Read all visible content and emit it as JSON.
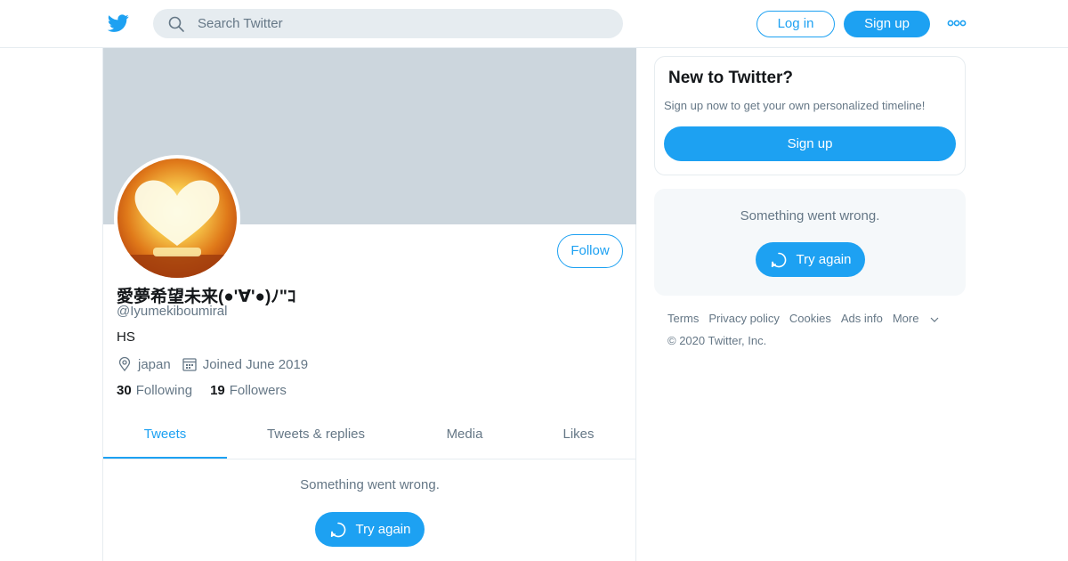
{
  "header": {
    "logo_icon": "twitter-bird-icon",
    "search_placeholder": "Search Twitter",
    "login_label": "Log in",
    "signup_label": "Sign up",
    "more_icon": "more-dots-icon"
  },
  "profile": {
    "display_name": "愛夢希望未来(●'∀'●)ﾉ\"ｺ",
    "handle": "@Iyumekiboumiral",
    "bio": "HS",
    "location": "japan",
    "joined": "Joined June 2019",
    "following_count": "30",
    "following_label": "Following",
    "followers_count": "19",
    "followers_label": "Followers",
    "follow_label": "Follow"
  },
  "tabs": [
    {
      "label": "Tweets",
      "active": true
    },
    {
      "label": "Tweets & replies",
      "active": false
    },
    {
      "label": "Media",
      "active": false
    },
    {
      "label": "Likes",
      "active": false
    }
  ],
  "timeline": {
    "error_text": "Something went wrong.",
    "retry_label": "Try again"
  },
  "sidebar": {
    "new_title": "New to Twitter?",
    "new_subtitle": "Sign up now to get your own personalized timeline!",
    "new_signup_label": "Sign up",
    "error_text": "Something went wrong.",
    "retry_label": "Try again"
  },
  "footer": {
    "links": [
      "Terms",
      "Privacy policy",
      "Cookies",
      "Ads info"
    ],
    "more_label": "More",
    "copyright": "© 2020 Twitter, Inc."
  },
  "colors": {
    "accent": "#1da1f2",
    "banner": "#ccd6dd",
    "muted_text": "#657786"
  }
}
